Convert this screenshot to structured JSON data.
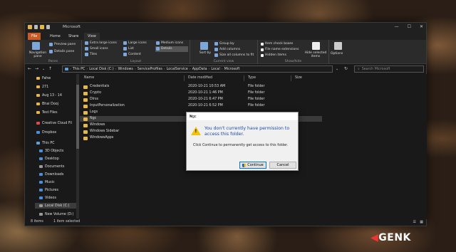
{
  "window": {
    "title": "Microsoft",
    "controls": [
      "—",
      "☐",
      "✕"
    ]
  },
  "tabs": [
    {
      "label": "File"
    },
    {
      "label": "Home"
    },
    {
      "label": "Share"
    },
    {
      "label": "View"
    }
  ],
  "ribbon": {
    "panes": {
      "nav_pane": "Navigation pane",
      "preview": "Preview pane",
      "details": "Details pane",
      "label": "Panes"
    },
    "layout": {
      "xl": "Extra large icons",
      "large": "Large icons",
      "medium": "Medium icons",
      "small": "Small icons",
      "list": "List",
      "details": "Details",
      "tiles": "Tiles",
      "content": "Content",
      "label": "Layout"
    },
    "current_view": {
      "sort": "Sort by",
      "group": "Group by",
      "add_cols": "Add columns",
      "size_cols": "Size all columns to fit",
      "label": "Current view"
    },
    "show_hide": {
      "checkboxes": "Item check boxes",
      "extensions": "File name extensions",
      "hidden": "Hidden items",
      "hide_sel": "Hide selected items",
      "label": "Show/hide"
    },
    "options": "Options"
  },
  "address": {
    "crumbs": [
      "This PC",
      "Local Disk (C:)",
      "Windows",
      "ServiceProfiles",
      "LocalService",
      "AppData",
      "Local",
      "Microsoft"
    ]
  },
  "search": {
    "placeholder": "Search Microsoft"
  },
  "nav": [
    {
      "label": "Fahw",
      "icon": "folder"
    },
    {
      "label": "271",
      "icon": "folder"
    },
    {
      "label": "Aug 13 - 14",
      "icon": "folder"
    },
    {
      "label": "Bhai Dooj",
      "icon": "folder"
    },
    {
      "label": "Test Files",
      "icon": "folder"
    },
    {
      "label": "Creative Cloud Fil",
      "icon": "cloud"
    },
    {
      "label": "Dropbox",
      "icon": "dropbox"
    },
    {
      "label": "This PC",
      "icon": "pc"
    },
    {
      "label": "3D Objects",
      "icon": "3d"
    },
    {
      "label": "Desktop",
      "icon": "desktop"
    },
    {
      "label": "Documents",
      "icon": "documents"
    },
    {
      "label": "Downloads",
      "icon": "downloads"
    },
    {
      "label": "Music",
      "icon": "music"
    },
    {
      "label": "Pictures",
      "icon": "pictures"
    },
    {
      "label": "Videos",
      "icon": "videos"
    },
    {
      "label": "Local Disk (C:)",
      "icon": "drive"
    },
    {
      "label": "New Volume (D:)",
      "icon": "drive"
    }
  ],
  "columns": {
    "name": "Name",
    "date": "Date modified",
    "type": "Type",
    "size": "Size"
  },
  "files": [
    {
      "name": "Credentials",
      "date": "2020-10-21 10:53 AM",
      "type": "File folder"
    },
    {
      "name": "Crypto",
      "date": "2020-10-21 1:46 PM",
      "type": "File folder"
    },
    {
      "name": "Dlrss",
      "date": "2020-10-21 6:47 PM",
      "type": "File folder"
    },
    {
      "name": "InputPersonalization",
      "date": "2020-10-21 6:52 PM",
      "type": "File folder"
    },
    {
      "name": "Logs",
      "date": "",
      "type": ""
    },
    {
      "name": "Ngc",
      "date": "",
      "type": ""
    },
    {
      "name": "Windows",
      "date": "",
      "type": ""
    },
    {
      "name": "Windows Sidebar",
      "date": "",
      "type": ""
    },
    {
      "name": "WindowsApps",
      "date": "",
      "type": ""
    }
  ],
  "status": {
    "items": "8 items",
    "selected": "1 item selected"
  },
  "dialog": {
    "title": "Ngc",
    "message": "You don't currently have permission to access this folder.",
    "sub": "Click Continue to permanently get access to this folder.",
    "continue": "Continue",
    "cancel": "Cancel"
  },
  "watermark": {
    "text": "GENK"
  }
}
